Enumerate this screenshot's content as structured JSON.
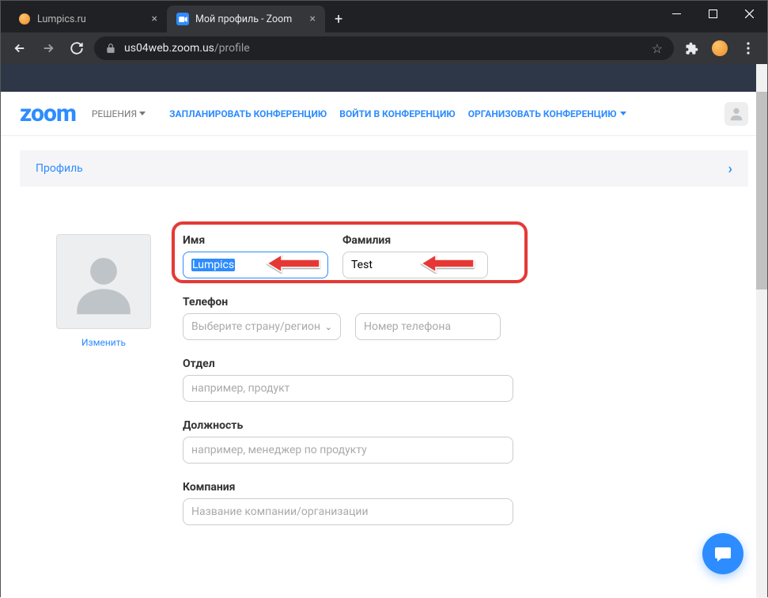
{
  "browser": {
    "tabs": [
      {
        "title": "Lumpics.ru",
        "active": false
      },
      {
        "title": "Мой профиль - Zoom",
        "active": true
      }
    ],
    "url_host": "us04web.zoom.us",
    "url_path": "/profile"
  },
  "header": {
    "logo": "zoom",
    "solutions": "РЕШЕНИЯ",
    "links": {
      "schedule": "ЗАПЛАНИРОВАТЬ КОНФЕРЕНЦИЮ",
      "join": "ВОЙТИ В КОНФЕРЕНЦИЮ",
      "host": "ОРГАНИЗОВАТЬ КОНФЕРЕНЦИЮ"
    }
  },
  "profile_bar": {
    "label": "Профиль"
  },
  "avatar": {
    "change": "Изменить"
  },
  "form": {
    "first_name_label": "Имя",
    "first_name_value": "Lumpics",
    "last_name_label": "Фамилия",
    "last_name_value": "Test",
    "phone_label": "Телефон",
    "phone_country_placeholder": "Выберите страну/регион",
    "phone_number_placeholder": "Номер телефона",
    "department_label": "Отдел",
    "department_placeholder": "например, продукт",
    "position_label": "Должность",
    "position_placeholder": "например, менеджер по продукту",
    "company_label": "Компания",
    "company_placeholder": "Название компании/организации"
  }
}
